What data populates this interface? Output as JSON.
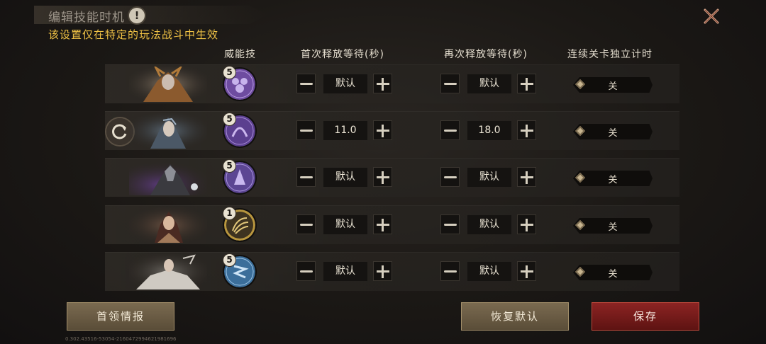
{
  "header": {
    "title": "编辑技能时机",
    "info_symbol": "!",
    "subtitle": "该设置仅在特定的玩法战斗中生效",
    "close_icon": "close-x-icon"
  },
  "columns": {
    "skill": "威能技",
    "first_wait": "首次释放等待(秒)",
    "second_wait": "再次释放等待(秒)",
    "stage_timer": "连续关卡独立计时"
  },
  "rows": [
    {
      "hero_icon": "hero-portrait-icon",
      "skill_level": "5",
      "skill_color": "#6e4ca0",
      "first": "默认",
      "second": "默认",
      "toggle": "关"
    },
    {
      "hero_icon": "hero-portrait-icon",
      "skill_level": "5",
      "skill_color": "#5b3f8f",
      "first": "11.0",
      "second": "18.0",
      "toggle": "关",
      "refresh_icon": "refresh-icon"
    },
    {
      "hero_icon": "hero-portrait-icon",
      "skill_level": "5",
      "skill_color": "#5c4693",
      "first": "默认",
      "second": "默认",
      "toggle": "关"
    },
    {
      "hero_icon": "hero-portrait-icon",
      "skill_level": "1",
      "skill_color": "#b8963e",
      "first": "默认",
      "second": "默认",
      "toggle": "关"
    },
    {
      "hero_icon": "hero-portrait-icon",
      "skill_level": "5",
      "skill_color": "#3b6e9a",
      "first": "默认",
      "second": "默认",
      "toggle": "关"
    }
  ],
  "buttons": {
    "intel": "首领情报",
    "reset": "恢复默认",
    "save": "保存"
  },
  "version": "0.302.43516-53054-2160472994621981696",
  "colors": {
    "subtitle": "#f0c245",
    "save_button": "#8c2423",
    "gold_button": "#7a6a50"
  }
}
